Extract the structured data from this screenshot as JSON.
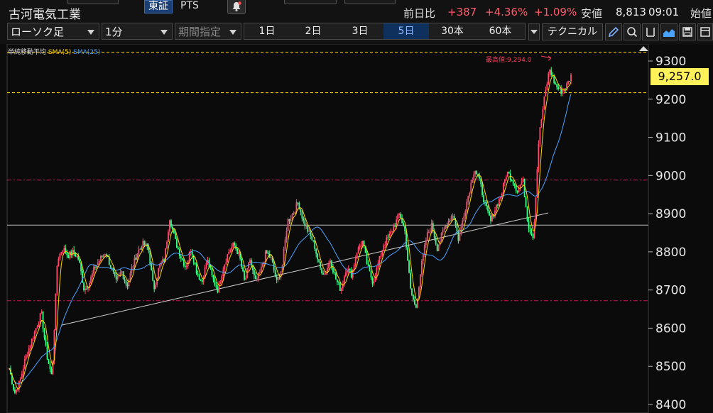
{
  "header": {
    "stock_name": "古河電気工業",
    "tabs": [
      {
        "label": "東証",
        "active": true
      },
      {
        "label": "PTS",
        "active": false
      }
    ],
    "quote": {
      "prev_day_label": "前日比",
      "change": "+387",
      "change_pct": "+4.36%",
      "change_pct2": "+1.09%",
      "low_label": "安値",
      "low_value": "8,813",
      "low_time": "09:01",
      "open_label": "始値"
    }
  },
  "toolbar": {
    "chart_type": "ローソク足",
    "interval": "1分",
    "period_placeholder": "期間指定",
    "ranges": [
      {
        "label": "1日",
        "active": false
      },
      {
        "label": "2日",
        "active": false
      },
      {
        "label": "3日",
        "active": false
      },
      {
        "label": "5日",
        "active": true
      },
      {
        "label": "30本",
        "active": false
      },
      {
        "label": "60本",
        "active": false
      }
    ],
    "technical_label": "テクニカル"
  },
  "chart": {
    "legend_main": "単純移動平均",
    "legend_sma5": "SMA(5)",
    "legend_sma25": "SMA(25)",
    "current_price": "9,257.0",
    "high_label": "最高値:9,294.0",
    "y_ticks": [
      9300,
      9200,
      9100,
      9000,
      8900,
      8800,
      8700,
      8600,
      8500,
      8400
    ],
    "colors": {
      "up": "#ff4d6d",
      "down": "#39ff88",
      "sma5": "#ffd700",
      "sma25": "#4aa3ff",
      "badge": "#fff15a",
      "high_marker": "#ff3b5c"
    }
  },
  "chart_data": {
    "type": "line",
    "y_axis": {
      "ylim": [
        8400,
        9330
      ],
      "ticks": [
        9300,
        9200,
        9100,
        9000,
        8900,
        8800,
        8700,
        8600,
        8500,
        8400
      ]
    },
    "horizontal_lines": [
      {
        "value": 9323,
        "style": "dashed",
        "color": "#ffd700"
      },
      {
        "value": 9217,
        "style": "dashed",
        "color": "#ffd700"
      },
      {
        "value": 8988,
        "style": "dash-dot",
        "color": "#c2185b"
      },
      {
        "value": 8870,
        "style": "solid",
        "color": "#bbbbbb"
      },
      {
        "value": 8672,
        "style": "dash-dot",
        "color": "#c2185b"
      }
    ],
    "trendline": {
      "start": 8608,
      "end": 8902,
      "color": "#cfcfcf"
    },
    "path_points": [
      8495,
      8430,
      8460,
      8520,
      8560,
      8600,
      8640,
      8530,
      8470,
      8780,
      8810,
      8790,
      8800,
      8780,
      8700,
      8720,
      8760,
      8780,
      8800,
      8760,
      8720,
      8750,
      8710,
      8760,
      8800,
      8820,
      8810,
      8700,
      8760,
      8780,
      8890,
      8830,
      8790,
      8760,
      8810,
      8750,
      8720,
      8780,
      8730,
      8700,
      8760,
      8800,
      8820,
      8790,
      8720,
      8780,
      8720,
      8750,
      8800,
      8780,
      8720,
      8760,
      8880,
      8900,
      8930,
      8880,
      8850,
      8820,
      8760,
      8740,
      8780,
      8730,
      8700,
      8760,
      8740,
      8800,
      8830,
      8760,
      8720,
      8770,
      8820,
      8840,
      8870,
      8900,
      8850,
      8700,
      8650,
      8760,
      8840,
      8870,
      8810,
      8850,
      8880,
      8900,
      8830,
      8900,
      8960,
      9020,
      8980,
      8920,
      8880,
      8920,
      8950,
      9010,
      8990,
      8960,
      8990,
      8870,
      8840,
      9100,
      9200,
      9280,
      9240,
      9220,
      9230,
      9260
    ]
  }
}
